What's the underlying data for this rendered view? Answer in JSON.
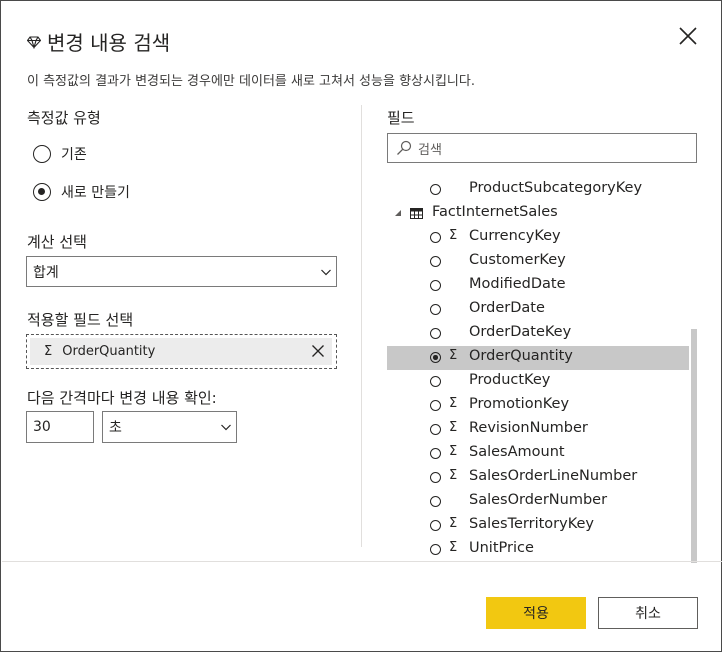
{
  "dialog": {
    "title": "변경 내용 검색",
    "description": "이 측정값의 결과가 변경되는 경우에만 데이터를 새로 고쳐서 성능을 향상시킵니다."
  },
  "measure_type": {
    "label": "측정값 유형",
    "options": [
      {
        "label": "기존",
        "selected": false
      },
      {
        "label": "새로 만들기",
        "selected": true
      }
    ]
  },
  "calculation": {
    "label": "계산 선택",
    "value": "합계"
  },
  "apply_field": {
    "label": "적용할 필드 선택",
    "value": "OrderQuantity",
    "sigma": "Σ"
  },
  "interval": {
    "label": "다음 간격마다 변경 내용 확인:",
    "value": "30",
    "unit": "초"
  },
  "fields": {
    "label": "필드",
    "search_placeholder": "검색",
    "items": [
      {
        "label": "ProductSubcategoryKey",
        "sigma": "",
        "selected": false
      },
      {
        "label": "FactInternetSales",
        "is_table": true
      },
      {
        "label": "CurrencyKey",
        "sigma": "Σ",
        "selected": false
      },
      {
        "label": "CustomerKey",
        "sigma": "",
        "selected": false
      },
      {
        "label": "ModifiedDate",
        "sigma": "",
        "selected": false
      },
      {
        "label": "OrderDate",
        "sigma": "",
        "selected": false
      },
      {
        "label": "OrderDateKey",
        "sigma": "",
        "selected": false
      },
      {
        "label": "OrderQuantity",
        "sigma": "Σ",
        "selected": true
      },
      {
        "label": "ProductKey",
        "sigma": "",
        "selected": false
      },
      {
        "label": "PromotionKey",
        "sigma": "Σ",
        "selected": false
      },
      {
        "label": "RevisionNumber",
        "sigma": "Σ",
        "selected": false
      },
      {
        "label": "SalesAmount",
        "sigma": "Σ",
        "selected": false
      },
      {
        "label": "SalesOrderLineNumber",
        "sigma": "Σ",
        "selected": false
      },
      {
        "label": "SalesOrderNumber",
        "sigma": "",
        "selected": false
      },
      {
        "label": "SalesTerritoryKey",
        "sigma": "Σ",
        "selected": false
      },
      {
        "label": "UnitPrice",
        "sigma": "Σ",
        "selected": false
      }
    ]
  },
  "buttons": {
    "apply": "적용",
    "cancel": "취소"
  },
  "colors": {
    "accent": "#F2C811",
    "selected_row": "#C8C8C8",
    "border": "#7A7A7A"
  }
}
